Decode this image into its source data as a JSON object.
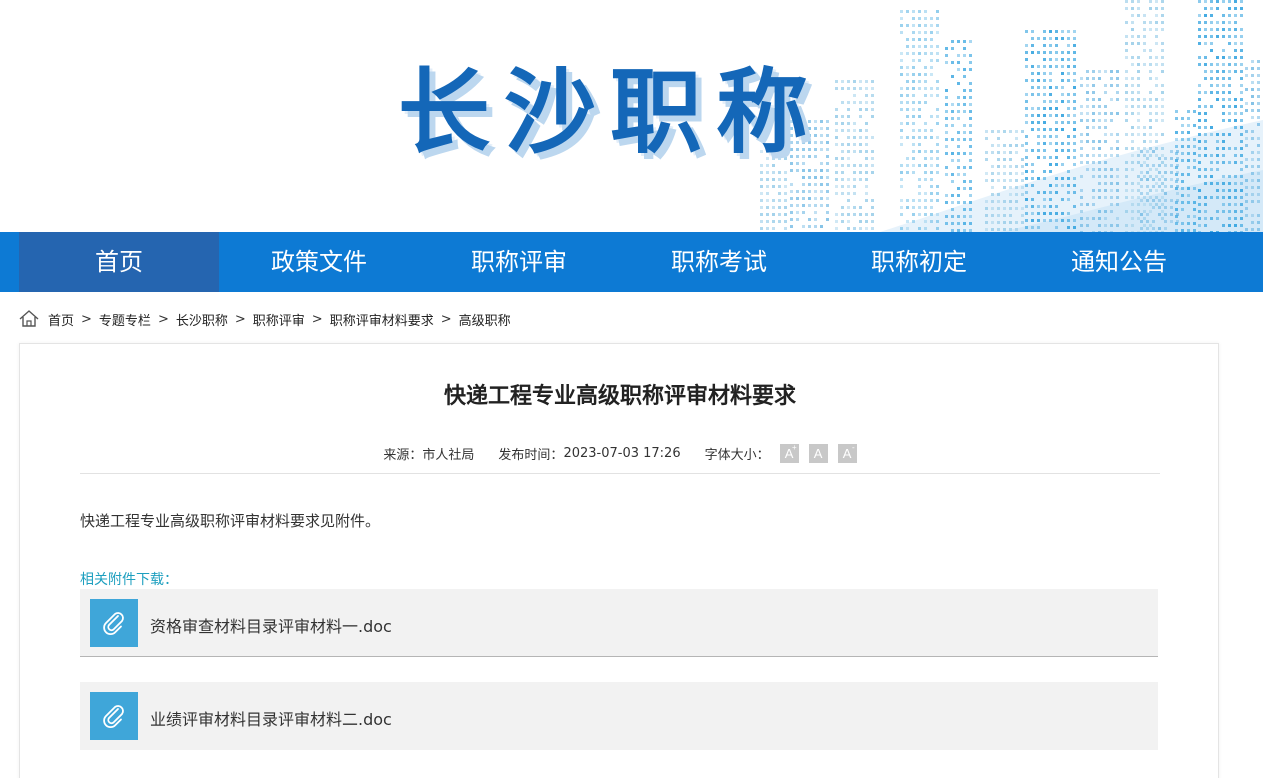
{
  "banner": {
    "title": "长沙职称"
  },
  "nav": {
    "items": [
      {
        "label": "首页",
        "active": true
      },
      {
        "label": "政策文件",
        "active": false
      },
      {
        "label": "职称评审",
        "active": false
      },
      {
        "label": "职称考试",
        "active": false
      },
      {
        "label": "职称初定",
        "active": false
      },
      {
        "label": "通知公告",
        "active": false
      }
    ]
  },
  "breadcrumb": {
    "icon": "home-icon",
    "separator": ">",
    "items": [
      "首页",
      "专题专栏",
      "长沙职称",
      "职称评审",
      "职称评审材料要求",
      "高级职称"
    ]
  },
  "article": {
    "title": "快递工程专业高级职称评审材料要求",
    "source_label": "来源：",
    "source": "市人社局",
    "time_label": "发布时间：",
    "time": "2023-07-03 17:26",
    "font_size_label": "字体大小：",
    "font_buttons": [
      {
        "label": "A",
        "mark": "+"
      },
      {
        "label": "A",
        "mark": ""
      },
      {
        "label": "A",
        "mark": "-"
      }
    ],
    "intro": "快递工程专业高级职称评审材料要求见附件。",
    "attachments_label": "相关附件下载：",
    "attachments": [
      {
        "name": "资格审查材料目录评审材料一.doc",
        "icon": "paperclip-icon"
      },
      {
        "name": "业绩评审材料目录评审材料二.doc",
        "icon": "paperclip-icon"
      }
    ]
  },
  "colors": {
    "nav_bg": "#0d7ad4",
    "nav_active": "#2565b0",
    "title_blue": "#1467b8",
    "attach_label": "#1d9fbf",
    "clip_bg": "#3fa6d9"
  }
}
